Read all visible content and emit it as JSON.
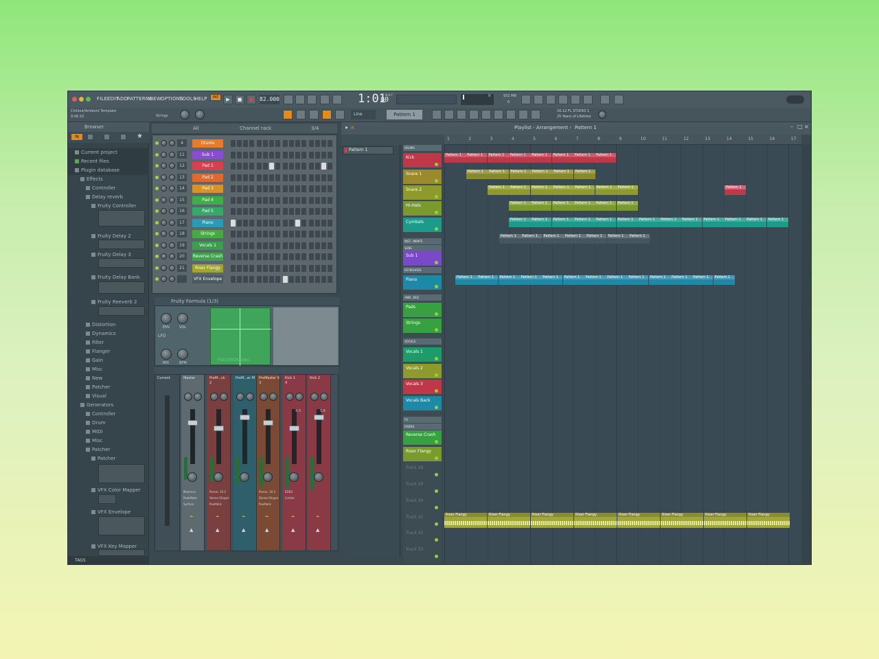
{
  "menu": {
    "items": [
      "FILE",
      "EDIT",
      "ADD",
      "PATTERNS",
      "VIEW",
      "OPTIONS",
      "TOOLS",
      "HELP"
    ],
    "pat_label": "PAT",
    "tempo": "82.000",
    "time": "1:01",
    "time_sub": "00",
    "time_unit": "M:S:T",
    "mem": "931 MB",
    "mem_sub": "0",
    "cpu": "9"
  },
  "project": {
    "name": "Chillout/Ambient Template",
    "time": "9:06:10",
    "hint": "Strings"
  },
  "toolbar2": {
    "snap": "Line",
    "pattern": "Pattern 1",
    "news_line1": "16.12 FL STUDIO 1",
    "news_line2": "25 Years of Lifetime"
  },
  "browser": {
    "title": "Browser",
    "items": [
      {
        "label": "Current project",
        "indent": 0
      },
      {
        "label": "Recent files",
        "indent": 0
      },
      {
        "label": "Plugin database",
        "indent": 0
      },
      {
        "label": "Effects",
        "indent": 1
      },
      {
        "label": "Controller",
        "indent": 2
      },
      {
        "label": "Delay reverb",
        "indent": 2
      },
      {
        "label": "Fruity Controller",
        "indent": 3
      },
      {
        "label": "Fruity Delay 2",
        "indent": 3
      },
      {
        "label": "Fruity Delay 3",
        "indent": 3
      },
      {
        "label": "Fruity Delay Bank",
        "indent": 3
      },
      {
        "label": "Fruity Reeverb 2",
        "indent": 3
      },
      {
        "label": "Distortion",
        "indent": 2
      },
      {
        "label": "Dynamics",
        "indent": 2
      },
      {
        "label": "Filter",
        "indent": 2
      },
      {
        "label": "Flanger",
        "indent": 2
      },
      {
        "label": "Gain",
        "indent": 2
      },
      {
        "label": "Misc",
        "indent": 2
      },
      {
        "label": "New",
        "indent": 2
      },
      {
        "label": "Patcher",
        "indent": 2
      },
      {
        "label": "Visual",
        "indent": 2
      },
      {
        "label": "Generators",
        "indent": 1
      },
      {
        "label": "Controller",
        "indent": 2
      },
      {
        "label": "Drum",
        "indent": 2
      },
      {
        "label": "MIDI",
        "indent": 2
      },
      {
        "label": "Misc",
        "indent": 2
      },
      {
        "label": "Patcher",
        "indent": 2
      },
      {
        "label": "Patcher",
        "indent": 3
      },
      {
        "label": "VFX Color Mapper",
        "indent": 3
      },
      {
        "label": "VFX Envelope",
        "indent": 3
      },
      {
        "label": "VFX Key Mapper",
        "indent": 3
      }
    ],
    "tags_label": "TAGS"
  },
  "channel_rack": {
    "filter": "All",
    "title": "Channel rack",
    "swing": "3/4",
    "channels": [
      {
        "num": "4",
        "name": "Drums",
        "color": "#e87b2b"
      },
      {
        "num": "11",
        "name": "Sub 1",
        "color": "#8a4bd6"
      },
      {
        "num": "12",
        "name": "Pad 1",
        "color": "#d7404c"
      },
      {
        "num": "13",
        "name": "Pad 2",
        "color": "#e06a2e"
      },
      {
        "num": "14",
        "name": "Pad 3",
        "color": "#d9922a"
      },
      {
        "num": "15",
        "name": "Pad 4",
        "color": "#3fae48"
      },
      {
        "num": "16",
        "name": "Pad 5",
        "color": "#35a86a"
      },
      {
        "num": "17",
        "name": "Piano",
        "color": "#2b9bb3"
      },
      {
        "num": "18",
        "name": "Strings",
        "color": "#46aa3e"
      },
      {
        "num": "19",
        "name": "Vocals 1",
        "color": "#3aa04d"
      },
      {
        "num": "20",
        "name": "Reverse Crash",
        "color": "#3ea34a"
      },
      {
        "num": "21",
        "name": "Riser Flangy",
        "color": "#a1a530"
      },
      {
        "num": "",
        "name": "VFX Envelope",
        "color": "#4a5a61"
      }
    ]
  },
  "plugin": {
    "title": "Fruity Formula (1/3)",
    "knob1": "ENV",
    "knob2": "VOL",
    "knob3": "MIX",
    "knob4": "BPM",
    "lfo": "LFO",
    "watermark": "PatchWizKnobs"
  },
  "mixer": {
    "strips": [
      {
        "name": "Current",
        "sub": "",
        "color": "#4a5a61",
        "fx": []
      },
      {
        "name": "Master",
        "sub": "",
        "color": "#5d6a70",
        "fx": [
          "Maximus",
          "PeakMatic",
          "Surface"
        ]
      },
      {
        "name": "PreM...ck",
        "sub": "2",
        "color": "#7a3f3f",
        "fx": [
          "Parom. 10 2",
          "Stereo Shaper",
          "PanMatic"
        ]
      },
      {
        "name": "PreM...er M",
        "sub": "",
        "color": "#2f5f6a",
        "fx": []
      },
      {
        "name": "PreMaster S",
        "sub": "3",
        "color": "#7a4a35",
        "fx": [
          "Parom. 10 2",
          "Stereo Shaper",
          "PanMatic"
        ]
      },
      {
        "name": "Kick 1",
        "sub": "4",
        "color": "#8a3a44",
        "fx": [
          "EDEO",
          "Limiter"
        ]
      },
      {
        "name": "Kick 2",
        "sub": "",
        "color": "#8a3a44",
        "fx": []
      }
    ],
    "meter1": "4.3",
    "meter2": "5.6"
  },
  "picker": {
    "item": "Pattern 1"
  },
  "playlist": {
    "title": "Playlist - Arrangement",
    "sep": "›",
    "pattern": "Pattern 1",
    "ruler": [
      "1",
      "2",
      "3",
      "4",
      "5",
      "6",
      "7",
      "8",
      "9",
      "10",
      "11",
      "12",
      "13",
      "14",
      "15",
      "16",
      "17"
    ],
    "groups": [
      {
        "label": "DRUMS",
        "top": 0
      },
      {
        "label": "INST...MENTS",
        "top": 0
      },
      {
        "label": "SUBS",
        "top": 0
      },
      {
        "label": "KEYBOARDS",
        "top": 0
      },
      {
        "label": "AMB...NCE",
        "top": 0
      },
      {
        "label": "VOCALS",
        "top": 0
      },
      {
        "label": "FX",
        "top": 0
      },
      {
        "label": "RISERS",
        "top": 0
      }
    ],
    "tracks": [
      {
        "name": "Kick",
        "color": "#c0374a"
      },
      {
        "name": "Snare 1",
        "color": "#9a8a2c"
      },
      {
        "name": "Snare 2",
        "color": "#8e9b2c"
      },
      {
        "name": "Hi-Hats",
        "color": "#7a9a2e"
      },
      {
        "name": "Cymbals",
        "color": "#1c9a8a"
      },
      {
        "name": "Sub 1",
        "color": "#7a4ac6"
      },
      {
        "name": "Piano",
        "color": "#1c8aa6"
      },
      {
        "name": "Pads",
        "color": "#37a040"
      },
      {
        "name": "Strings",
        "color": "#37a040"
      },
      {
        "name": "Vocals 1",
        "color": "#1e9b6a"
      },
      {
        "name": "Vocals 2",
        "color": "#8e9b2c"
      },
      {
        "name": "Vocals 3",
        "color": "#c0374a"
      },
      {
        "name": "Vocals Back",
        "color": "#1c8aa6"
      },
      {
        "name": "Reverse Crash",
        "color": "#37a040"
      },
      {
        "name": "Riser Flangy",
        "color": "#7a9a2e"
      },
      {
        "name": "Track 28",
        "color": "#3d4c53"
      },
      {
        "name": "Track 29",
        "color": "#3d4c53"
      },
      {
        "name": "Track 30",
        "color": "#3d4c53"
      },
      {
        "name": "Track 31",
        "color": "#3d4c53"
      },
      {
        "name": "Track 32",
        "color": "#3d4c53"
      },
      {
        "name": "Track 33",
        "color": "#3d4c53"
      }
    ],
    "clip_label": "Pattern 1",
    "riser_label": "Riser Flangy"
  }
}
